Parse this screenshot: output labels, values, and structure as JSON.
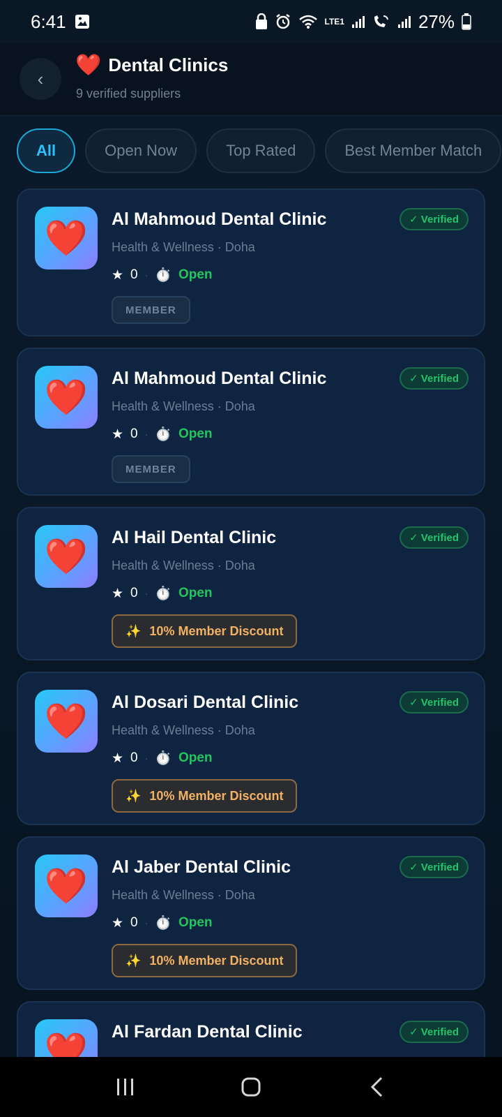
{
  "status_bar": {
    "time": "6:41",
    "battery": "27%",
    "network": "LTE1"
  },
  "header": {
    "title_icon": "❤️",
    "title": "Dental Clinics",
    "subtitle": "9 verified suppliers"
  },
  "filters": [
    {
      "label": "All",
      "active": true
    },
    {
      "label": "Open Now",
      "active": false
    },
    {
      "label": "Top Rated",
      "active": false
    },
    {
      "label": "Best Member Match",
      "active": false
    }
  ],
  "cards": [
    {
      "icon": "❤️",
      "name": "Al Mahmoud Dental Clinic",
      "meta": "Health & Wellness · Doha",
      "rating": "0",
      "status": "Open",
      "verified": "✓ Verified",
      "badge_type": "member",
      "badge": "MEMBER",
      "badge_icon": ""
    },
    {
      "icon": "❤️",
      "name": "Al Mahmoud Dental Clinic",
      "meta": "Health & Wellness · Doha",
      "rating": "0",
      "status": "Open",
      "verified": "✓ Verified",
      "badge_type": "member",
      "badge": "MEMBER",
      "badge_icon": ""
    },
    {
      "icon": "❤️",
      "name": "Al Hail Dental Clinic",
      "meta": "Health & Wellness · Doha",
      "rating": "0",
      "status": "Open",
      "verified": "✓ Verified",
      "badge_type": "discount",
      "badge": "10% Member Discount",
      "badge_icon": "✨"
    },
    {
      "icon": "❤️",
      "name": "Al Dosari Dental Clinic",
      "meta": "Health & Wellness · Doha",
      "rating": "0",
      "status": "Open",
      "verified": "✓ Verified",
      "badge_type": "discount",
      "badge": "10% Member Discount",
      "badge_icon": "✨"
    },
    {
      "icon": "❤️",
      "name": "Al Jaber Dental Clinic",
      "meta": "Health & Wellness · Doha",
      "rating": "0",
      "status": "Open",
      "verified": "✓ Verified",
      "badge_type": "discount",
      "badge": "10% Member Discount",
      "badge_icon": "✨"
    },
    {
      "icon": "❤️",
      "name": "Al Fardan Dental Clinic",
      "meta": "",
      "rating": "",
      "status": "",
      "verified": "✓ Verified",
      "badge_type": "",
      "badge": "",
      "badge_icon": ""
    }
  ],
  "nav": {
    "recents": "|||",
    "home": "◯",
    "back": "‹"
  }
}
